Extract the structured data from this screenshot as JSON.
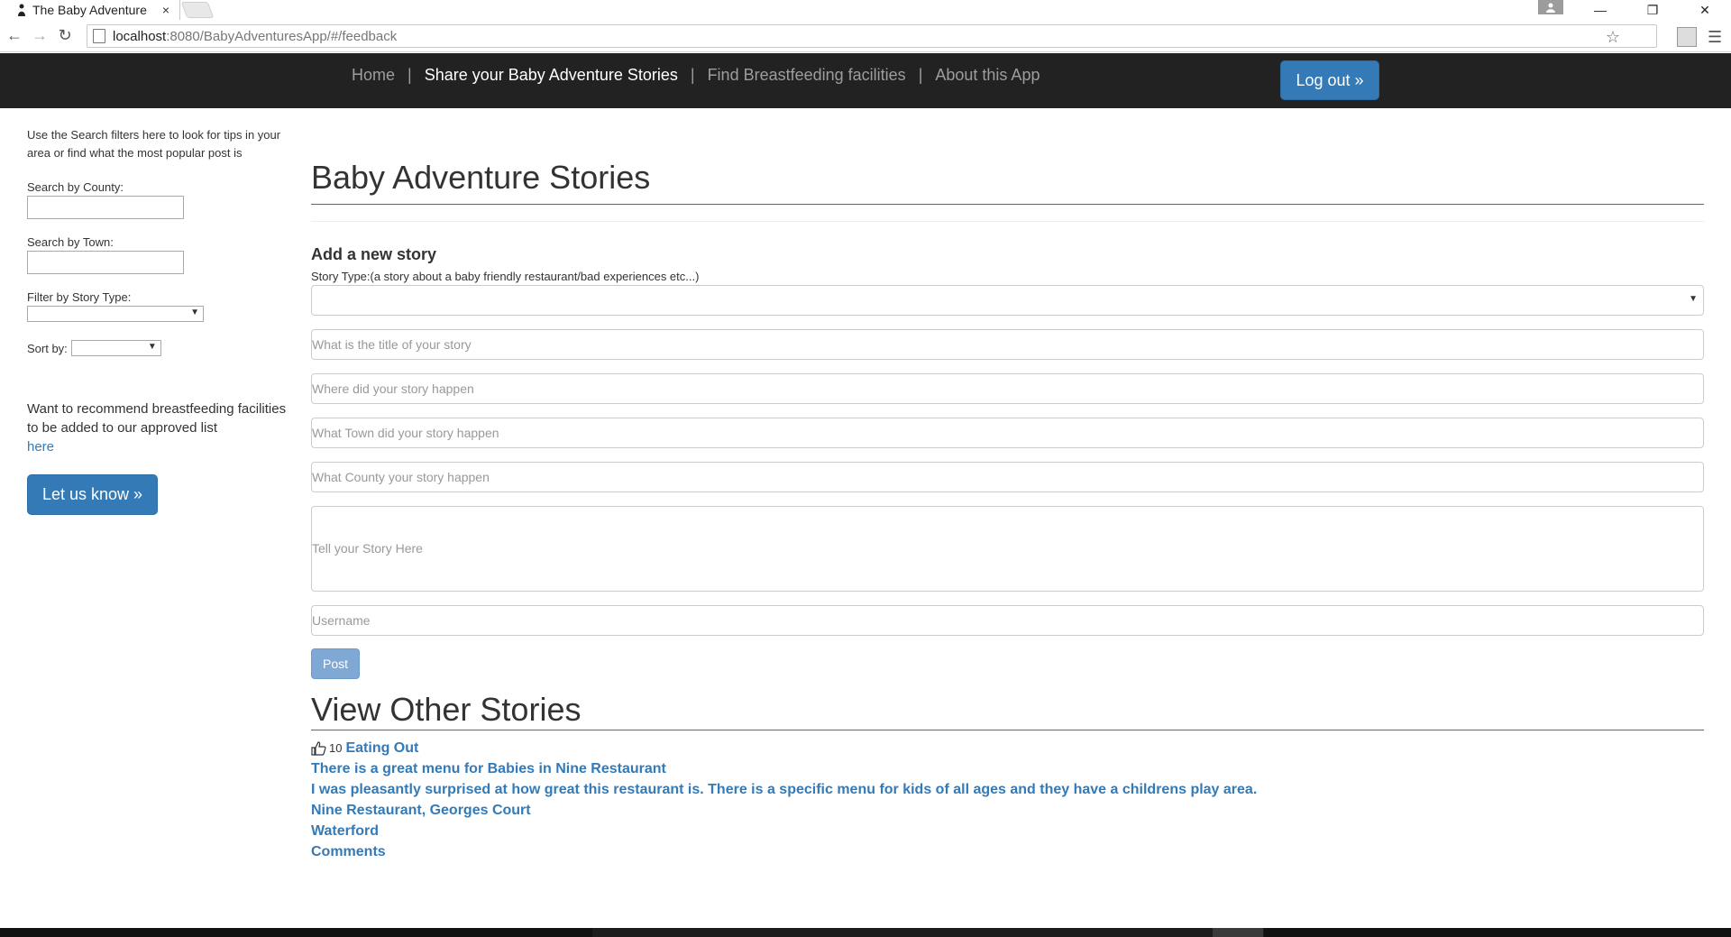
{
  "browser": {
    "tab_title": "The Baby Adventure",
    "tab_close": "×",
    "url_host": "localhost",
    "url_path": ":8080/BabyAdventuresApp/#/feedback",
    "win_minimize": "—",
    "win_restore": "❐",
    "win_close": "✕"
  },
  "navbar": {
    "links": [
      "Home",
      "Share your Baby Adventure Stories",
      "Find Breastfeeding facilities",
      "About this App"
    ],
    "separator": "|",
    "active_index": 1,
    "logout_label": "Log out »"
  },
  "sidebar": {
    "intro": "Use the Search filters here to look for tips in your area or find what the most popular post is",
    "county_label": "Search by County:",
    "town_label": "Search by Town:",
    "story_type_label": "Filter by Story Type:",
    "sort_label": "Sort by:",
    "recommend_text": "Want to recommend breastfeeding facilities to be added to our approved list",
    "recommend_link": "here",
    "letusknow_label": "Let us know »"
  },
  "main": {
    "title": "Baby Adventure Stories",
    "add_heading": "Add a new story",
    "story_type_label": "Story Type:(a story about a baby friendly restaurant/bad experiences etc...)",
    "placeholders": {
      "title": "What is the title of your story",
      "where": "Where did your story happen",
      "town": "What Town did your story happen",
      "county": "What County your story happen",
      "story": "Tell your Story Here",
      "username": "Username"
    },
    "post_label": "Post",
    "view_heading": "View Other Stories",
    "story": {
      "likes": "10",
      "type": "Eating Out",
      "title": "There is a great menu for Babies in Nine Restaurant",
      "body": "I was pleasantly surprised at how great this restaurant is. There is a specific menu for kids of all ages and they have a childrens play area.",
      "location": "Nine Restaurant, Georges Court",
      "county": "Waterford",
      "comments": "Comments"
    }
  },
  "colors": {
    "navbar_bg": "#222222",
    "primary": "#337ab7",
    "post_disabled": "#7fa9d4"
  }
}
